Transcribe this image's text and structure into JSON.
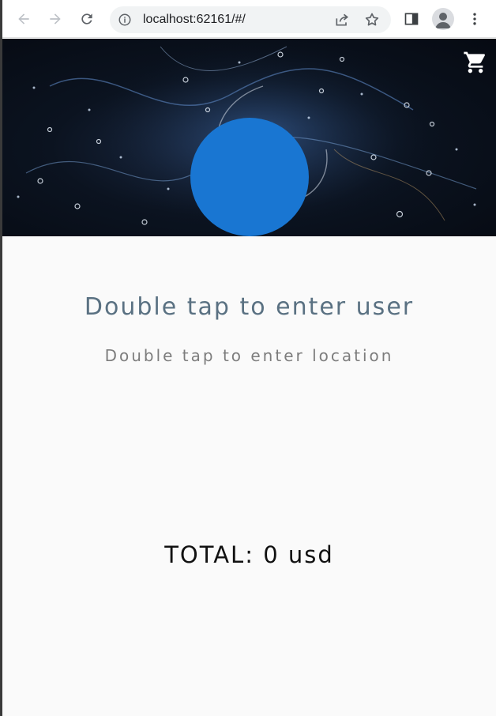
{
  "browser": {
    "url": "localhost:62161/#/",
    "icons": {
      "back": "arrow-left-icon",
      "forward": "arrow-right-icon",
      "reload": "reload-icon",
      "info": "info-icon",
      "share": "share-icon",
      "bookmark": "star-icon",
      "side_panel": "side-panel-icon",
      "profile": "profile-icon",
      "menu": "kebab-menu-icon"
    }
  },
  "app": {
    "header": {
      "cart_icon": "shopping-cart-icon",
      "avatar_color": "#1976d2"
    },
    "user_name_prompt": "Double tap to enter user",
    "location_prompt": "Double tap to enter location",
    "total_label": "TOTAL: 0 usd"
  },
  "colors": {
    "page_background": "#fafafa",
    "user_text": "#5a7182",
    "location_text": "#7d7d7d",
    "total_text": "#111111"
  }
}
